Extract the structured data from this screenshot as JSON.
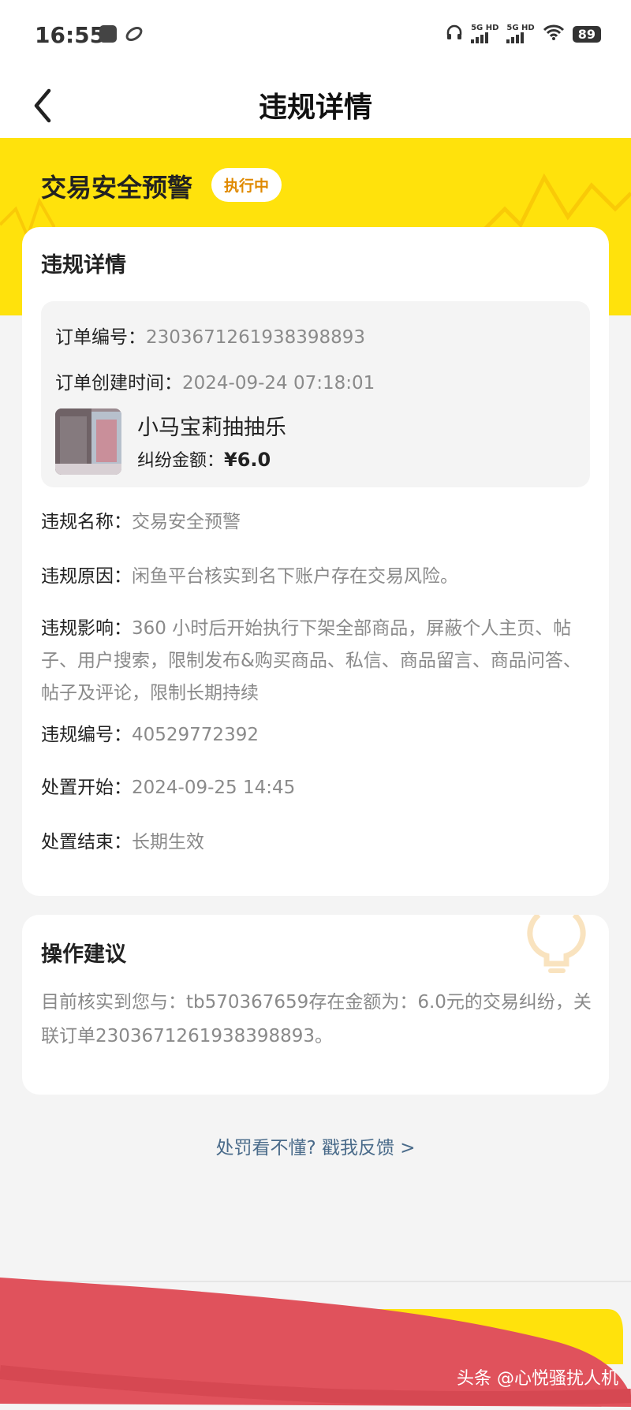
{
  "status_bar": {
    "time": "16:55",
    "network1": "5G HD",
    "network2": "5G HD",
    "battery": "89"
  },
  "nav": {
    "title": "违规详情"
  },
  "hero": {
    "title": "交易安全预警",
    "badge": "执行中"
  },
  "detail_card": {
    "title": "违规详情",
    "order": {
      "number_label": "订单编号：",
      "number_value": "2303671261938398893",
      "created_label": "订单创建时间：",
      "created_value": "2024-09-24 07:18:01",
      "product_name": "小马宝莉抽抽乐",
      "amount_label": "纠纷金额：",
      "amount_value": "¥6.0"
    },
    "rows": [
      {
        "label": "违规名称：",
        "value": "交易安全预警"
      },
      {
        "label": "违规原因：",
        "value": "闲鱼平台核实到名下账户存在交易风险。"
      },
      {
        "label": "违规影响：",
        "value": "360 小时后开始执行下架全部商品，屏蔽个人主页、帖子、用户搜索，限制发布&购买商品、私信、商品留言、商品问答、帖子及评论，限制长期持续"
      },
      {
        "label": "违规编号：",
        "value": "40529772392"
      },
      {
        "label": "处置开始：",
        "value": "2024-09-25 14:45"
      },
      {
        "label": "处置结束：",
        "value": "长期生效"
      }
    ]
  },
  "advice_card": {
    "title": "操作建议",
    "text": "目前核实到您与：tb570367659存在金额为：6.0元的交易纠纷，关联订单2303671261938398893。"
  },
  "feedback_link": "处罚看不懂? 戳我反馈 >",
  "watermark": "头条 @心悦骚扰人机",
  "colors": {
    "brand_yellow": "#ffe20c",
    "badge_text": "#e08a00",
    "link": "#4a6b8a",
    "redaction": "#e0525c"
  }
}
